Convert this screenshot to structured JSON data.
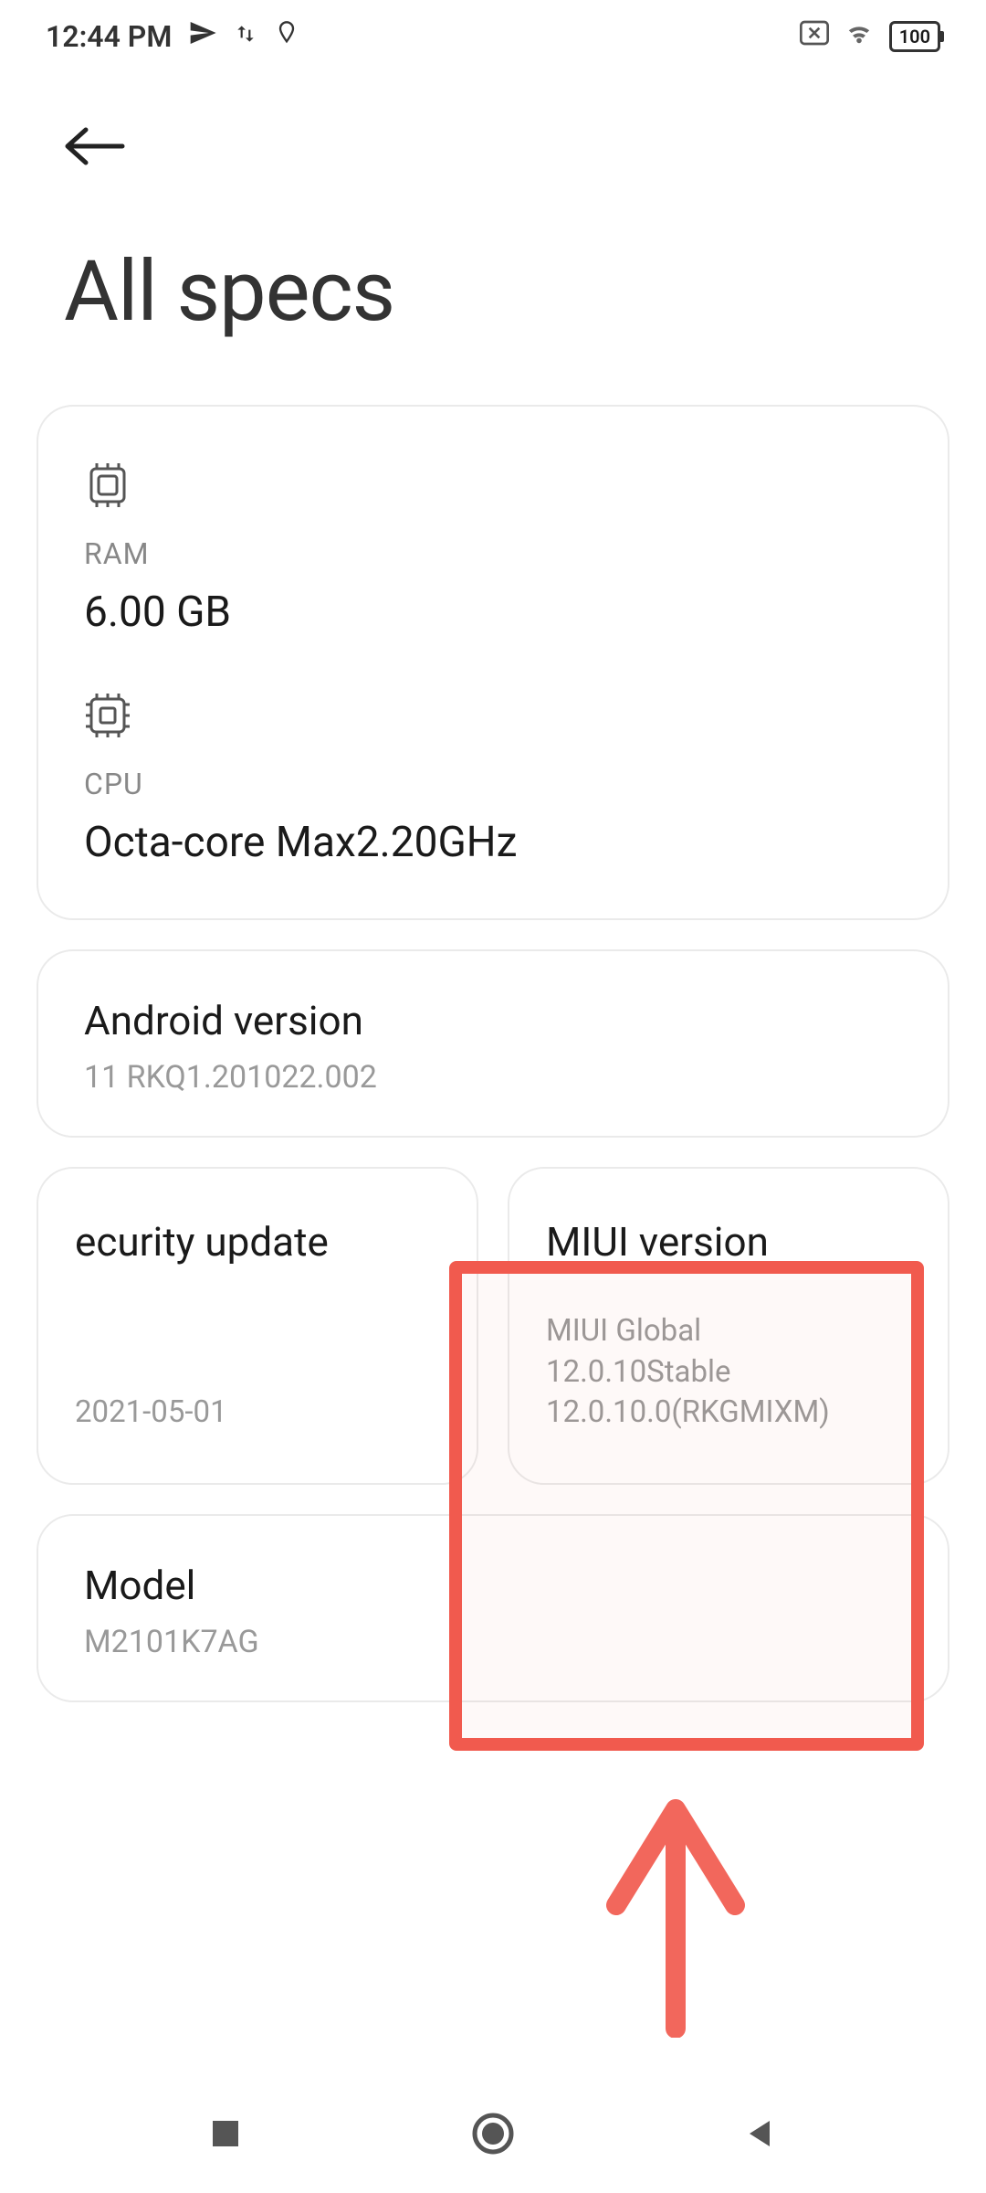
{
  "status": {
    "time": "12:44 PM",
    "battery": "100"
  },
  "page": {
    "title": "All specs"
  },
  "hardware": {
    "ram": {
      "label": "RAM",
      "value": "6.00 GB"
    },
    "cpu": {
      "label": "CPU",
      "value": "Octa-core Max2.20GHz"
    }
  },
  "android": {
    "title": "Android version",
    "value": "11 RKQ1.201022.002"
  },
  "security": {
    "title": "ecurity update",
    "value": "2021-05-01"
  },
  "miui": {
    "title": "MIUI version",
    "line1": "MIUI Global",
    "line2": "12.0.10Stable",
    "line3": "12.0.10.0(RKGMIXM)"
  },
  "model": {
    "title": "Model",
    "value": "M2101K7AG"
  }
}
